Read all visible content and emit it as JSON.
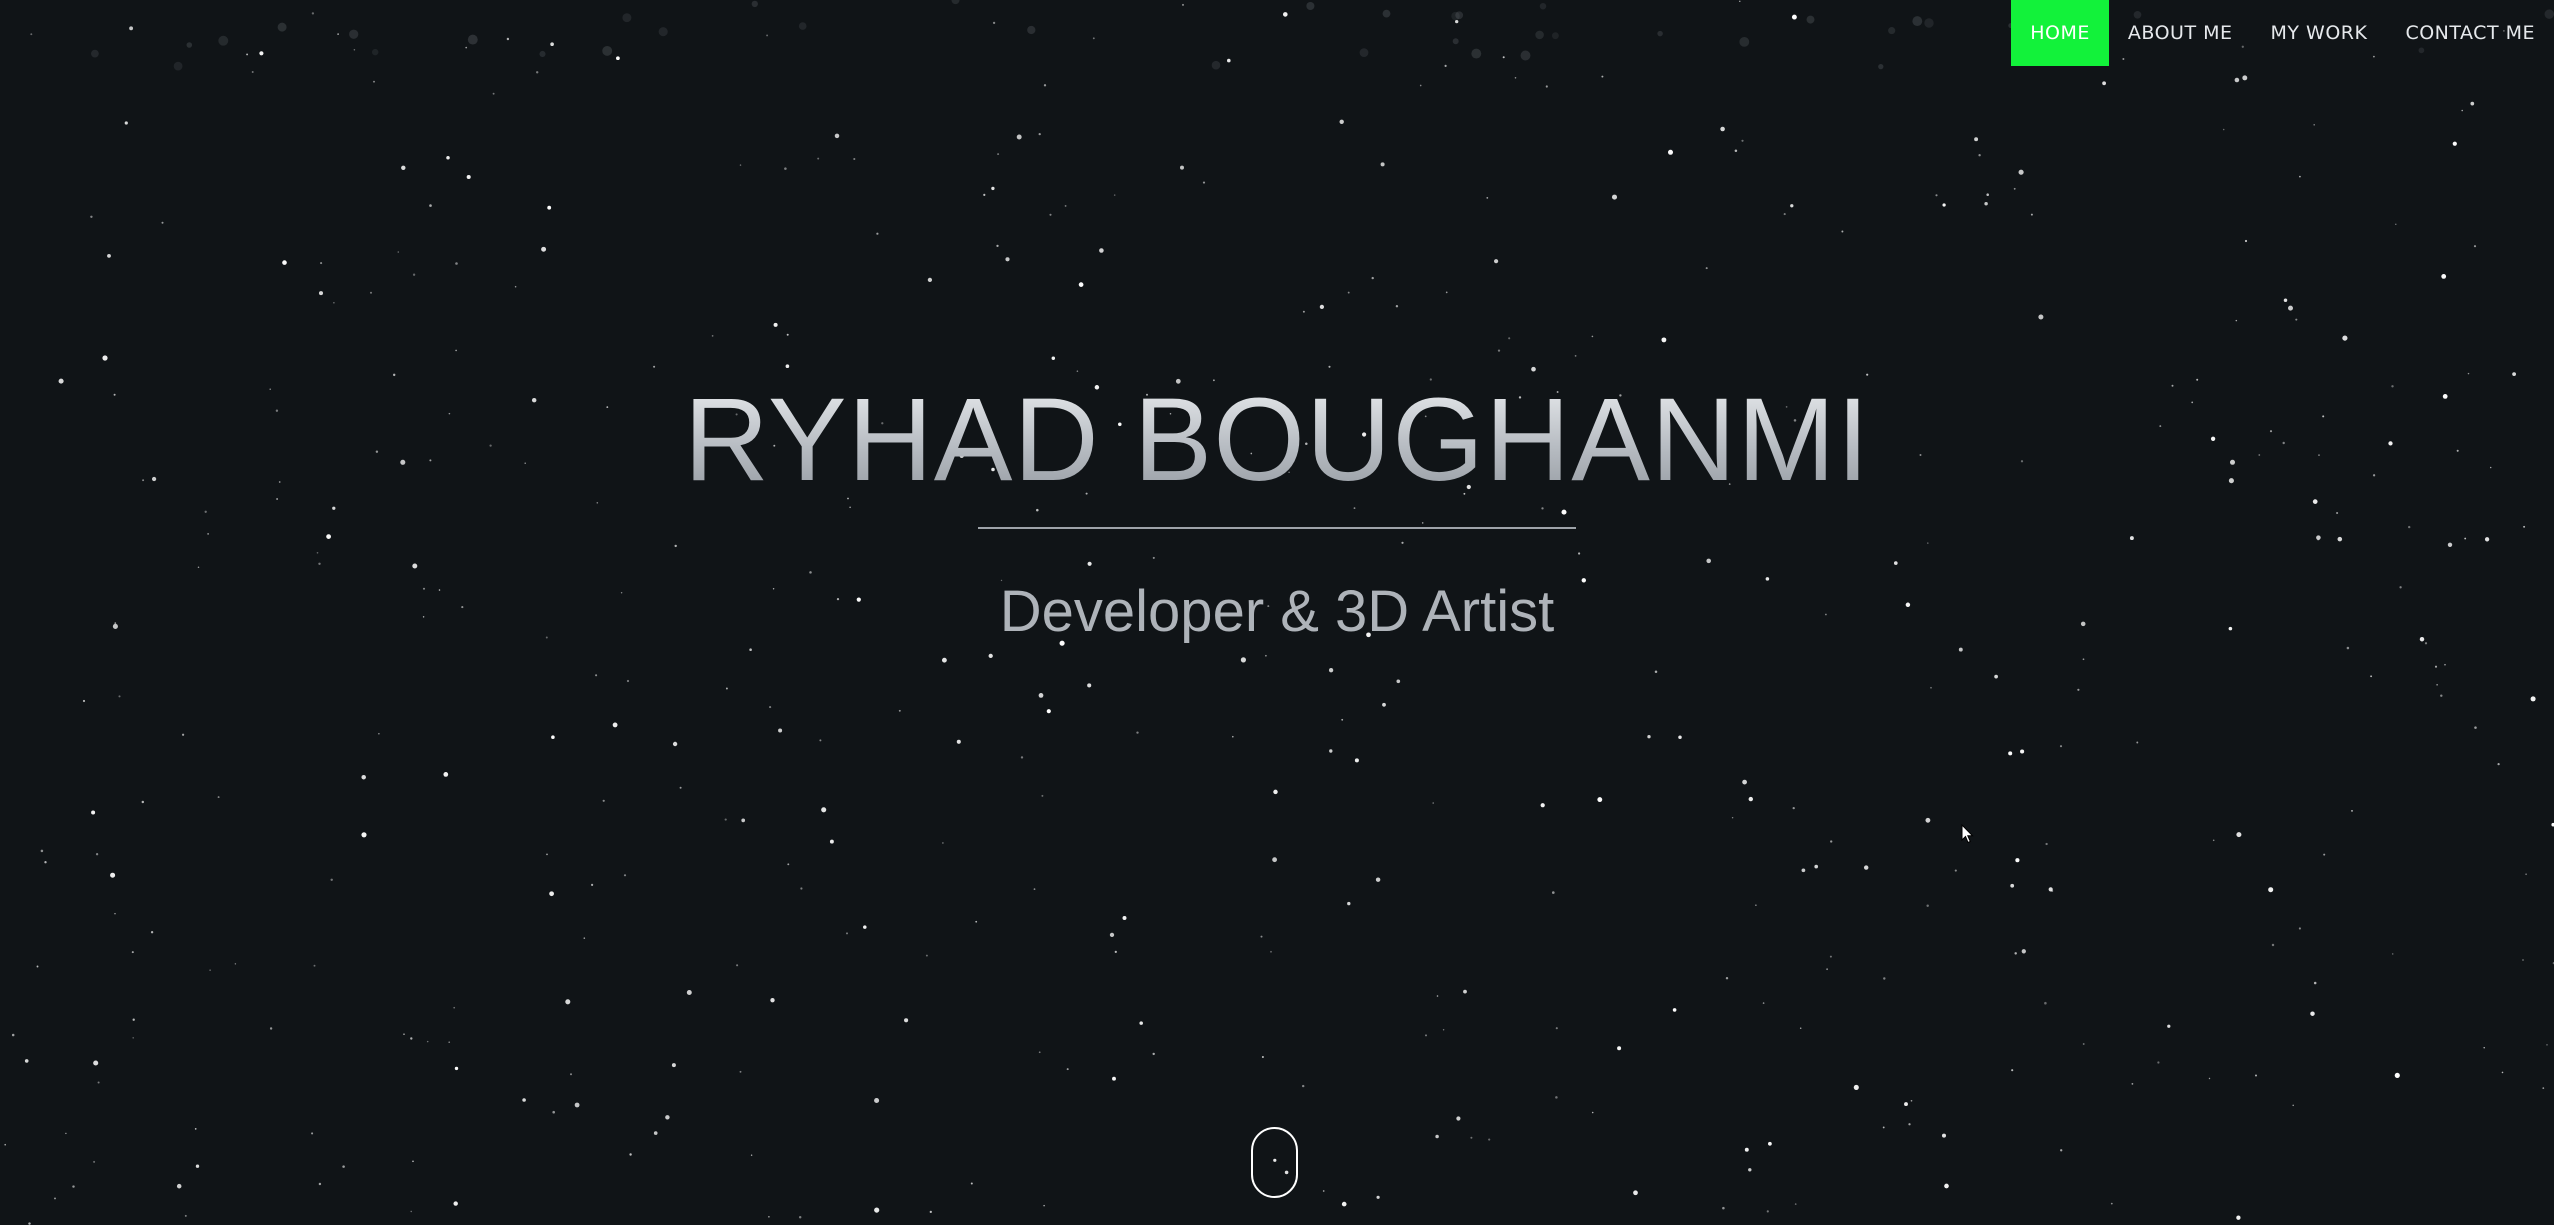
{
  "nav": {
    "items": [
      {
        "label": "HOME",
        "active": true
      },
      {
        "label": "ABOUT ME",
        "active": false
      },
      {
        "label": "MY WORK",
        "active": false
      },
      {
        "label": "CONTACT ME",
        "active": false
      }
    ]
  },
  "hero": {
    "title": "RYHAD BOUGHANMI",
    "subtitle": "Developer & 3D Artist"
  },
  "scroll_indicator": {
    "icon": "mouse-scroll-icon"
  },
  "colors": {
    "background": "#101417",
    "accent": "#12f23a",
    "nav_text": "#e6e9ec",
    "title_gradient_top": "#f1f3f5",
    "title_gradient_bottom": "#8e949b",
    "star": "#ffffff"
  }
}
